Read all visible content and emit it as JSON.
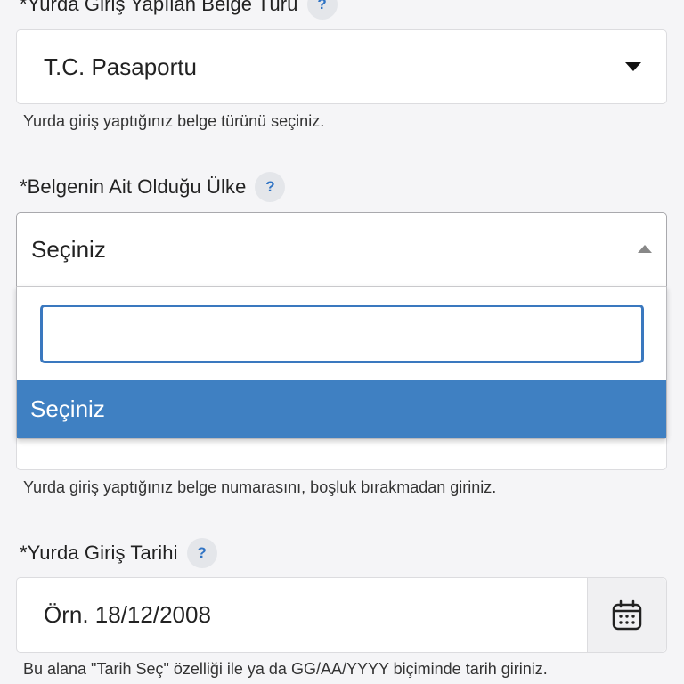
{
  "form": {
    "belge_turu": {
      "label": "*Yurda Giriş Yapılan Belge Türü",
      "help": "?",
      "value": "T.C. Pasaportu",
      "hint": "Yurda giriş yaptığınız belge türünü seçiniz."
    },
    "ulke": {
      "label": "*Belgenin Ait Olduğu Ülke",
      "help": "?",
      "value": "Seçiniz",
      "search_value": "",
      "options": [
        "Seçiniz"
      ]
    },
    "belge_no": {
      "hint": "Yurda giriş yaptığınız belge numarasını, boşluk bırakmadan giriniz."
    },
    "giris_tarihi": {
      "label": "*Yurda Giriş Tarihi",
      "help": "?",
      "placeholder": "Örn. 18/12/2008",
      "hint": "Bu alana \"Tarih Seç\" özelliği ile ya da GG/AA/YYYY biçiminde tarih giriniz.",
      "button_icon": "calendar-icon"
    }
  },
  "colors": {
    "accent": "#3f80c2",
    "help_text": "#2f73c4",
    "background": "#f5f5f7"
  }
}
